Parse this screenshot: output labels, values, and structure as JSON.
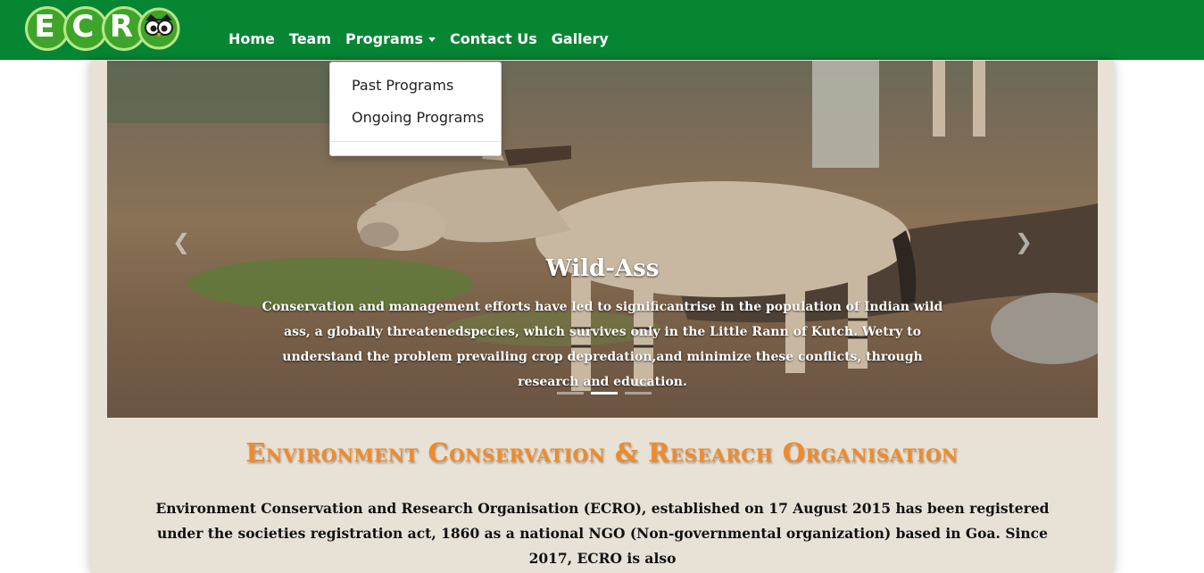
{
  "brand": {
    "logo_letters": [
      "E",
      "C",
      "R"
    ]
  },
  "nav": {
    "items": [
      "Home",
      "Team",
      "Programs",
      "Contact Us",
      "Gallery"
    ]
  },
  "dropdown": {
    "items": [
      "Past Programs",
      "Ongoing Programs"
    ]
  },
  "carousel": {
    "title": "Wild-Ass",
    "text": "Conservation and management efforts have led to significantrise in the population of Indian wild ass, a globally threatenedspecies, which survives only in the Little Rann of Kutch. Wetry to understand the problem prevailing crop depredation,and minimize these conflicts, through research and education.",
    "prev_icon": "chevron-left-icon",
    "next_icon": "chevron-right-icon",
    "indicator_count": 3,
    "active_indicator": 2
  },
  "main": {
    "heading": "Environment Conservation & Research Organisation",
    "intro": "Environment Conservation and Research Organisation (ECRO), established on 17 August 2015 has been registered under the societies registration act, 1860 as a national NGO (Non-governmental organization) based in Goa. Since 2017, ECRO is also"
  },
  "colors": {
    "navbar": "#068633",
    "heading": "#f08a2a",
    "page_bg": "#e8e2d6"
  }
}
